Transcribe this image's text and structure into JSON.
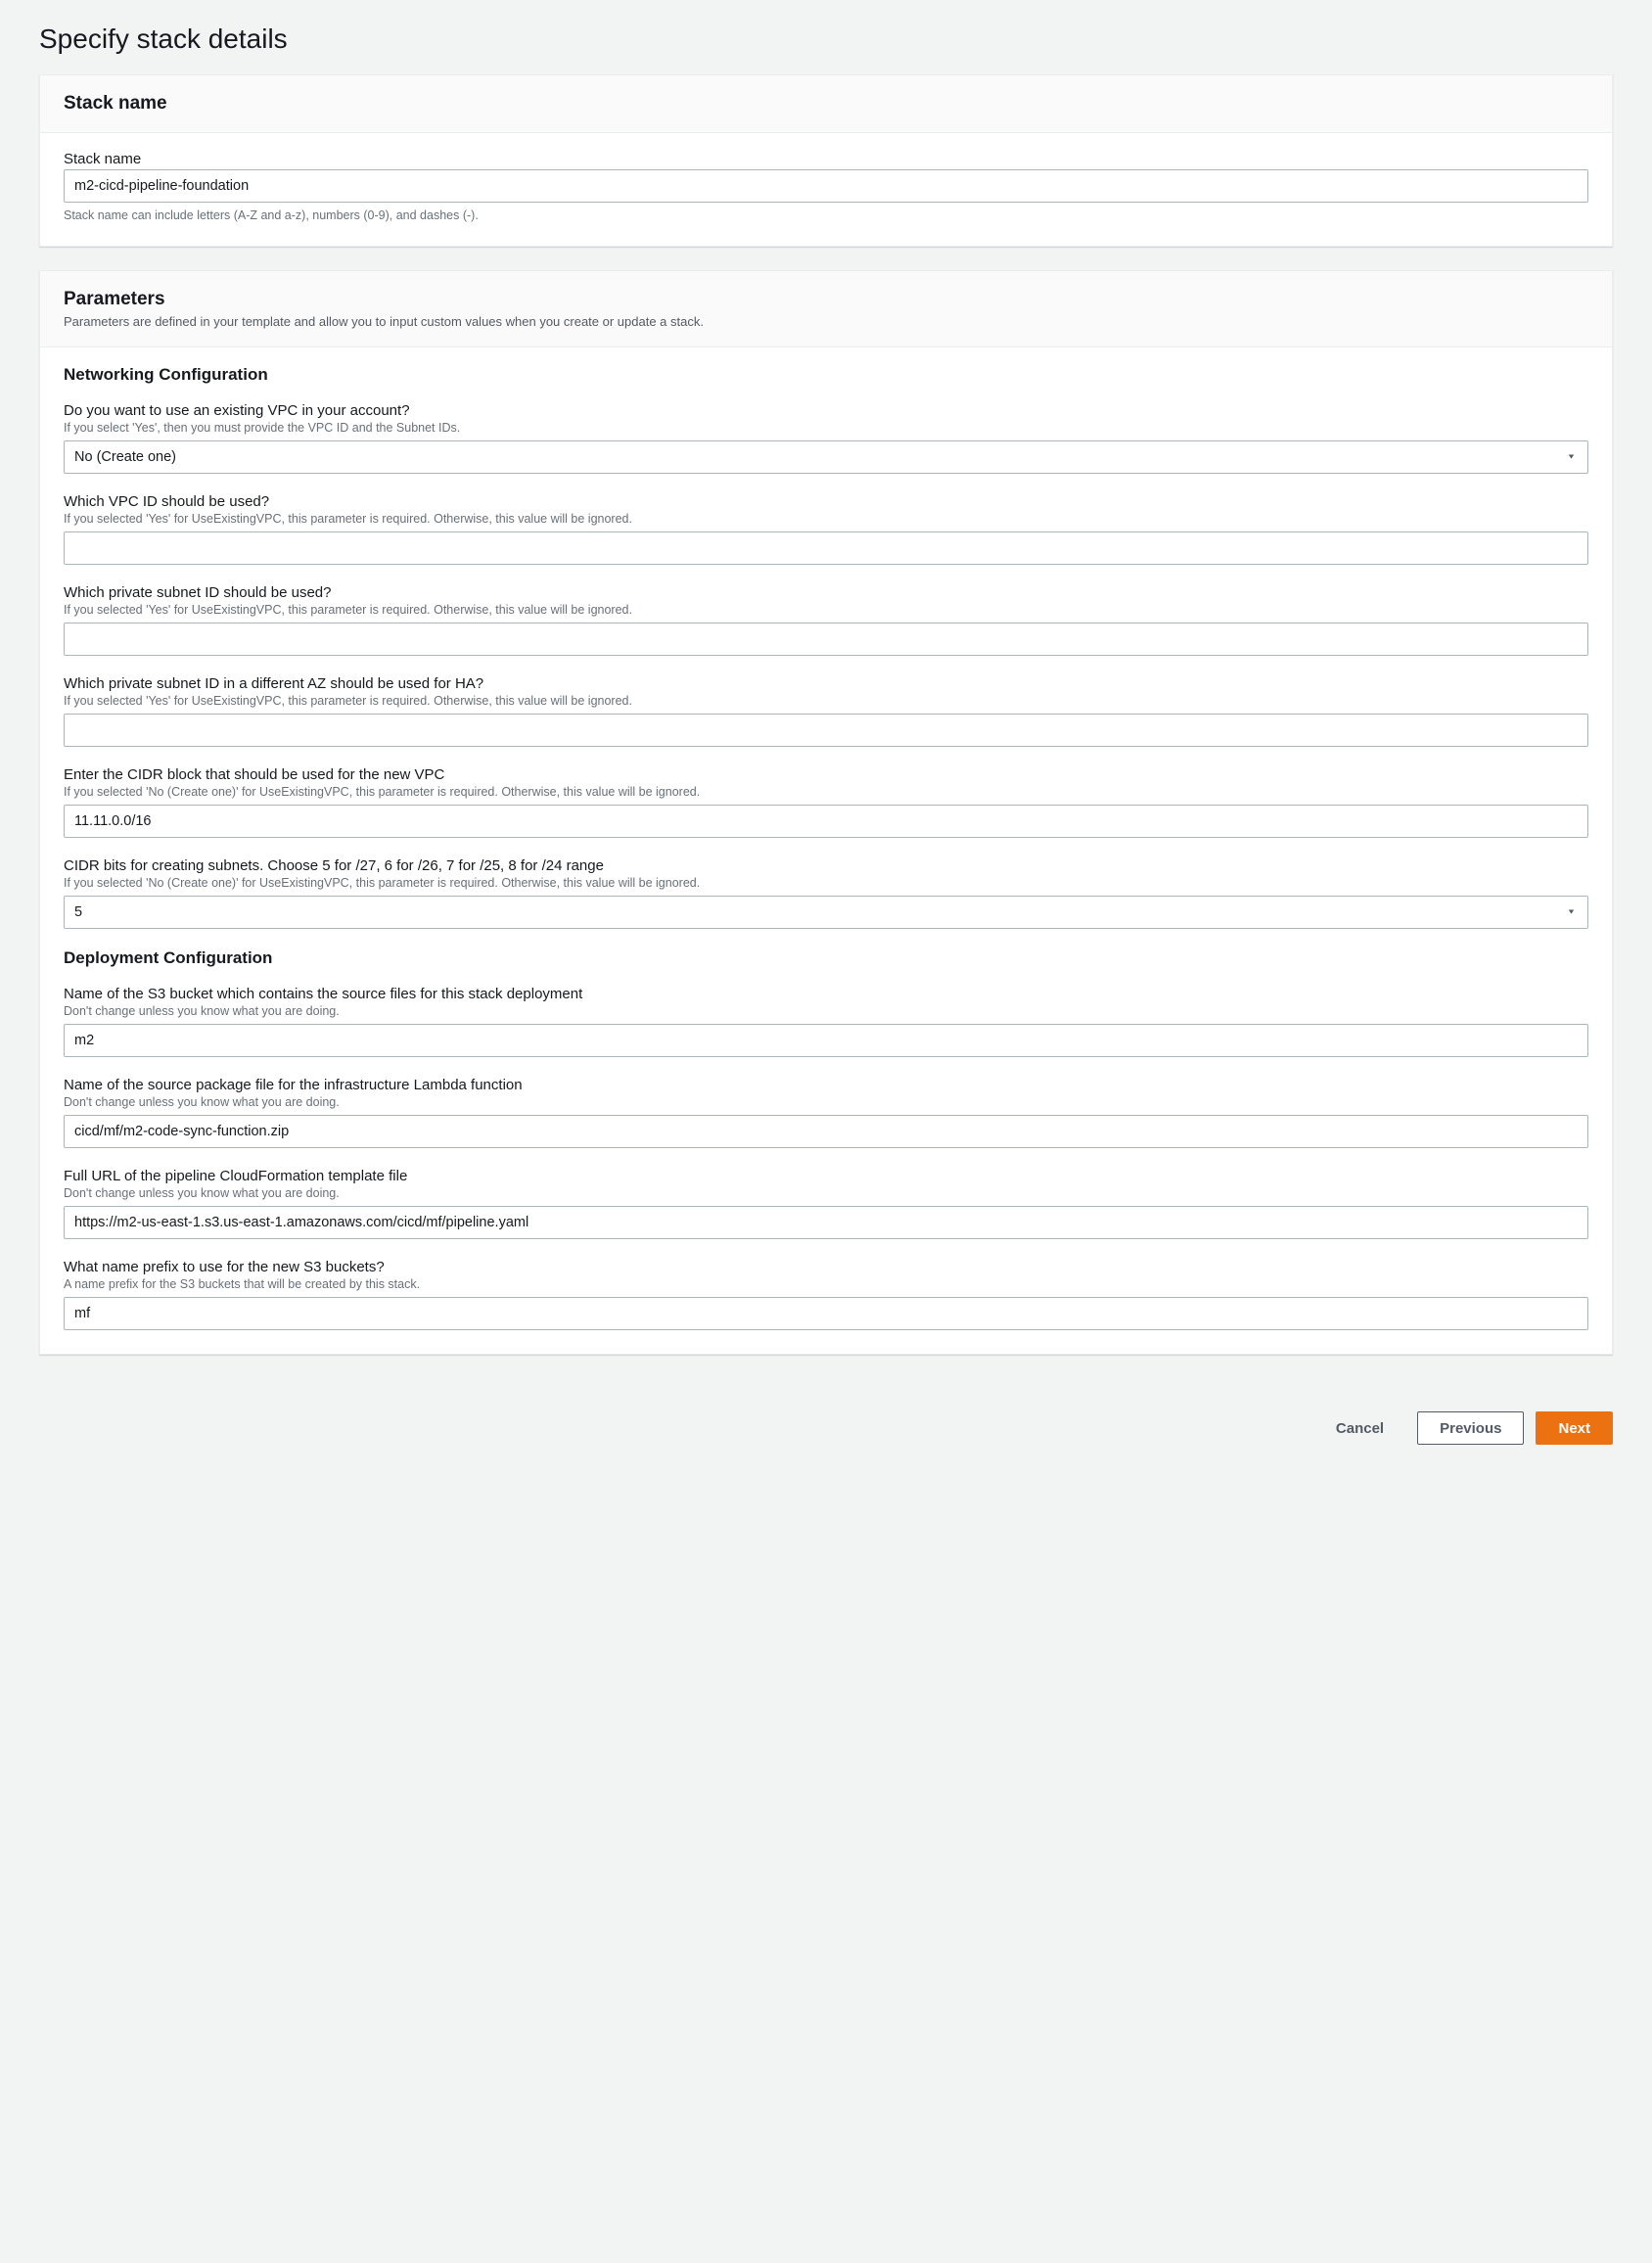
{
  "page": {
    "title": "Specify stack details",
    "buttons": {
      "cancel": "Cancel",
      "previous": "Previous",
      "next": "Next"
    }
  },
  "stackName": {
    "panelTitle": "Stack name",
    "label": "Stack name",
    "value": "m2-cicd-pipeline-foundation",
    "hint": "Stack name can include letters (A-Z and a-z), numbers (0-9), and dashes (-)."
  },
  "parameters": {
    "panelTitle": "Parameters",
    "panelDescription": "Parameters are defined in your template and allow you to input custom values when you create or update a stack.",
    "networking": {
      "heading": "Networking Configuration",
      "useExistingVpc": {
        "label": "Do you want to use an existing VPC in your account?",
        "description": "If you select 'Yes', then you must provide the VPC ID and the Subnet IDs.",
        "value": "No (Create one)"
      },
      "vpcId": {
        "label": "Which VPC ID should be used?",
        "description": "If you selected 'Yes' for UseExistingVPC, this parameter is required. Otherwise, this value will be ignored.",
        "value": ""
      },
      "privateSubnet": {
        "label": "Which private subnet ID should be used?",
        "description": "If you selected 'Yes' for UseExistingVPC, this parameter is required. Otherwise, this value will be ignored.",
        "value": ""
      },
      "privateSubnetHa": {
        "label": "Which private subnet ID in a different AZ should be used for HA?",
        "description": "If you selected 'Yes' for UseExistingVPC, this parameter is required. Otherwise, this value will be ignored.",
        "value": ""
      },
      "cidrBlock": {
        "label": "Enter the CIDR block that should be used for the new VPC",
        "description": "If you selected 'No (Create one)' for UseExistingVPC, this parameter is required. Otherwise, this value will be ignored.",
        "value": "11.11.0.0/16"
      },
      "cidrBits": {
        "label": "CIDR bits for creating subnets. Choose 5 for /27, 6 for /26, 7 for /25, 8 for /24 range",
        "description": "If you selected 'No (Create one)' for UseExistingVPC, this parameter is required. Otherwise, this value will be ignored.",
        "value": "5"
      }
    },
    "deployment": {
      "heading": "Deployment Configuration",
      "s3Bucket": {
        "label": "Name of the S3 bucket which contains the source files for this stack deployment",
        "description": "Don't change unless you know what you are doing.",
        "value": "m2"
      },
      "sourcePackage": {
        "label": "Name of the source package file for the infrastructure Lambda function",
        "description": "Don't change unless you know what you are doing.",
        "value": "cicd/mf/m2-code-sync-function.zip"
      },
      "templateUrl": {
        "label": "Full URL of the pipeline CloudFormation template file",
        "description": "Don't change unless you know what you are doing.",
        "value": "https://m2-us-east-1.s3.us-east-1.amazonaws.com/cicd/mf/pipeline.yaml"
      },
      "namePrefix": {
        "label": "What name prefix to use for the new S3 buckets?",
        "description": "A name prefix for the S3 buckets that will be created by this stack.",
        "value": "mf"
      }
    }
  }
}
